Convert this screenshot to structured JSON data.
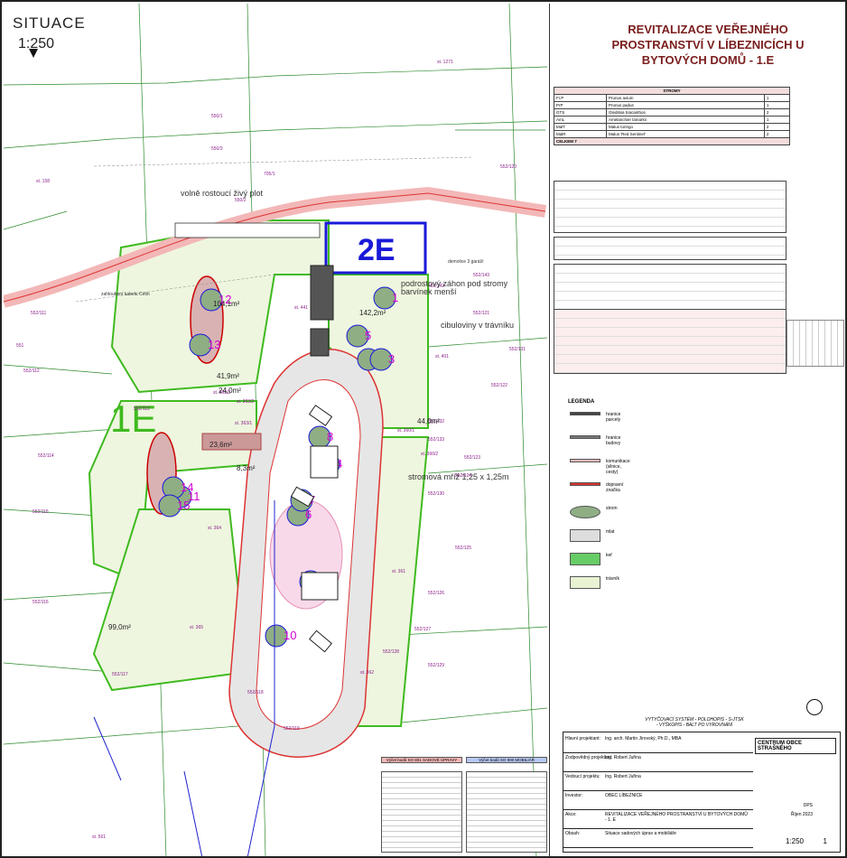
{
  "map": {
    "heading": "SITUACE",
    "scale": "1:250",
    "area_label": "1E",
    "building_label": "2E",
    "parcels": [
      "550/1",
      "550/3",
      "550/2",
      "st. 1271",
      "705/1",
      "st. 158",
      "552/111",
      "552/112",
      "552/113",
      "552/114",
      "552/115",
      "552/116",
      "552/117",
      "552/118",
      "552/119",
      "552/120",
      "552/121",
      "552/122",
      "552/123",
      "552/124",
      "552/125",
      "552/126",
      "552/127",
      "552/128",
      "552/129",
      "552/130",
      "552/131",
      "552/132",
      "552/133",
      "552/142",
      "552/143",
      "551",
      "st. 441",
      "st. 401",
      "st. 364",
      "st. 365",
      "st. 361",
      "st. 362",
      "st. 363/1",
      "st. 363/2",
      "st. 363/3",
      "st. 360/1",
      "st. 360/2",
      "st. 561"
    ],
    "annotations": [
      "volně rostoucí živý plot",
      "podrostový záhon pod stromy barvínek menší",
      "cibuloviny v trávníku",
      "stromová mříž 1,25 x 1,25m",
      "zahloubení kabelu Cetin",
      "demolice 3 garáží"
    ],
    "areas": [
      "104,1m²",
      "142,2m²",
      "41,9m²",
      "24,0m²",
      "23,6m²",
      "8,3m²",
      "44,0m²",
      "99,0m²"
    ],
    "tree_numbers": [
      "1",
      "2",
      "3",
      "4",
      "5",
      "6",
      "7",
      "8",
      "9",
      "10",
      "11",
      "12",
      "13",
      "14",
      "15"
    ]
  },
  "panel": {
    "title": "REVITALIZACE VEŘEJNÉHO PROSTRANSTVÍ V LÍBEZNICÍCH U BYTOVÝCH DOMŮ - 1.E",
    "legend_heading": "LEGENDA",
    "legend_items": [
      "hranice parcely",
      "hranice budovy",
      "komunikace (silnice, cesty)",
      "dopravní značka",
      "strom",
      "mlat",
      "keř",
      "trávník"
    ],
    "survey_note": "VYTYČOVACÍ SYSTÉM - POLOHOPIS - S-JTSK\n- VÝŠKOPIS - BALT PO VYROVNÁNÍ"
  },
  "tables": {
    "trees": {
      "title": "STROMY",
      "rows": [
        [
          "Fr.P",
          "Prunus avium",
          "1"
        ],
        [
          "PrP",
          "Prunus padus",
          "1"
        ],
        [
          "GTS",
          "Gleditsia triacanthos",
          "2"
        ],
        [
          "AmL",
          "Amelanchier lamarkii",
          "1"
        ],
        [
          "MalT",
          "Malus toringo",
          "2"
        ],
        [
          "MalR",
          "Malus 'Red Sentinel'",
          "2"
        ]
      ],
      "total": "CELKEM 7"
    }
  },
  "stamp": {
    "rows": [
      [
        "Hlavní projektant:",
        "Ing. arch. Martin Jirovský, Ph.D., MBA"
      ],
      [
        "Zodpovědný projektant:",
        "Ing. Robert Juřina"
      ],
      [
        "Vedoucí projektu:",
        "Ing. Robert Juřina"
      ],
      [
        "Investor:",
        "OBEC LÍBEZNICE"
      ],
      [
        "Akce:",
        "REVITALIZACE VEŘEJNÉHO PROSTRANSTVÍ U BYTOVÝCH DOMŮ - 1. E"
      ],
      [
        "Obsah:",
        "Situace sadových úprav a mobiliáře"
      ]
    ],
    "company": "CENTRUM OBCE STRAŠNÉHO",
    "format": "DPS",
    "date": "Říjen 2023",
    "scale": "1:250",
    "drawing_no": "1"
  },
  "points_tables": [
    {
      "title": "Výčet bodů SO 801 SADOVÉ ÚPRAVY",
      "color": "#f4b6b6"
    },
    {
      "title": "Výčet bodů SO 900 MOBILIÁŘ",
      "color": "#b6c8f4"
    }
  ],
  "colors": {
    "boundary": "#3fba1f",
    "magenta": "#d100d1",
    "blue": "#2020d0",
    "red": "#d02020",
    "path": "#f0b0b0",
    "grass": "#e8f3d4",
    "parcel": "#8a1e8a"
  }
}
